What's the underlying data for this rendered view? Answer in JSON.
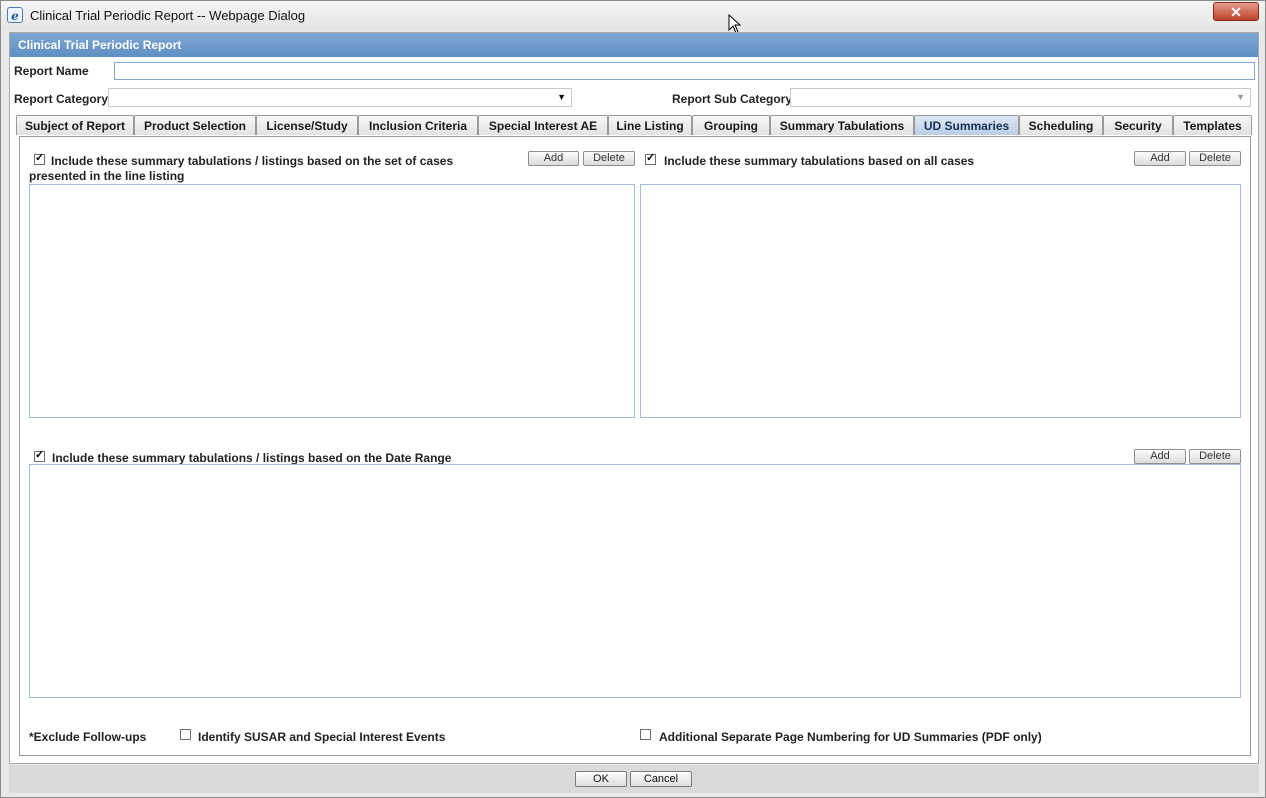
{
  "window": {
    "title": "Clinical Trial Periodic Report -- Webpage Dialog",
    "close_glyph": "✕"
  },
  "panel": {
    "header": "Clinical Trial Periodic Report"
  },
  "form": {
    "report_name_label": "Report Name",
    "report_name_value": "",
    "report_category_label": "Report Category",
    "report_category_value": "",
    "report_sub_category_label": "Report Sub Category",
    "report_sub_category_value": ""
  },
  "tabs": [
    {
      "label": "Subject of Report",
      "active": false
    },
    {
      "label": "Product Selection",
      "active": false
    },
    {
      "label": "License/Study",
      "active": false
    },
    {
      "label": "Inclusion Criteria",
      "active": false
    },
    {
      "label": "Special Interest AE",
      "active": false
    },
    {
      "label": "Line Listing",
      "active": false
    },
    {
      "label": "Grouping",
      "active": false
    },
    {
      "label": "Summary Tabulations",
      "active": false
    },
    {
      "label": "UD Summaries",
      "active": true
    },
    {
      "label": "Scheduling",
      "active": false
    },
    {
      "label": "Security",
      "active": false
    },
    {
      "label": "Templates",
      "active": false
    }
  ],
  "sections": {
    "line_listing": {
      "label": "Include these summary tabulations / listings based on the set of cases presented in the line listing",
      "checked": true,
      "add": "Add",
      "delete": "Delete"
    },
    "all_cases": {
      "label": "Include these summary tabulations based on all cases",
      "checked": true,
      "add": "Add",
      "delete": "Delete"
    },
    "date_range": {
      "label": "Include these summary tabulations / listings based on the Date Range",
      "checked": true,
      "add": "Add",
      "delete": "Delete"
    }
  },
  "options": {
    "exclude_followups": "*Exclude Follow-ups",
    "identify_susar": {
      "label": "Identify SUSAR and Special Interest Events",
      "checked": false
    },
    "separate_numbering": {
      "label": "Additional Separate Page Numbering for UD Summaries (PDF only)",
      "checked": false
    }
  },
  "footer": {
    "ok": "OK",
    "cancel": "Cancel"
  },
  "check_glyph": "✓"
}
